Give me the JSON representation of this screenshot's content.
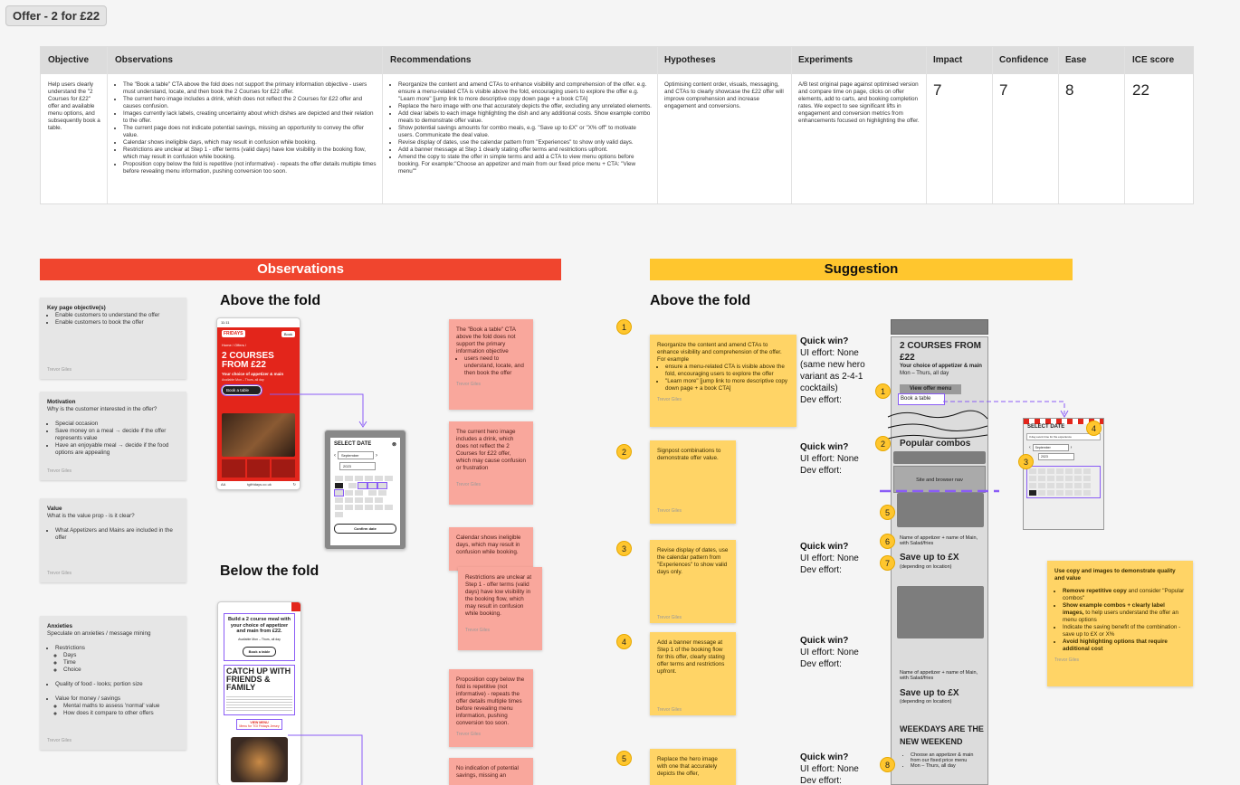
{
  "frame": {
    "title": "Offer - 2 for £22"
  },
  "table": {
    "headers": [
      "Objective",
      "Observations",
      "Recommendations",
      "Hypotheses",
      "Experiments",
      "Impact",
      "Confidence",
      "Ease",
      "ICE score"
    ],
    "objective": "Help users clearly understand the \"2 Courses for £22\" offer and available menu options, and subsequently book a table.",
    "observations": [
      "The \"Book a table\" CTA above the fold does not support the primary information objective - users must understand, locate, and then book the 2 Courses for £22 offer.",
      "The current hero image includes a drink, which does not reflect the 2 Courses for £22 offer and causes confusion.",
      "Images currently lack labels, creating uncertainty about which dishes are depicted and their relation to the offer.",
      "The current page does not indicate potential savings, missing an opportunity to convey the offer value.",
      "Calendar shows ineligible days, which may result in confusion while booking.",
      "Restrictions are unclear at Step 1 - offer terms (valid days) have low visibility in the booking flow, which may result in confusion while booking.",
      "Proposition copy below the fold is repetitive (not informative) - repeats the offer details multiple times before revealing menu information, pushing conversion too soon."
    ],
    "recommendations": [
      "Reorganize the content and amend CTAs to enhance visibility and comprehension of the offer. e.g. ensure a menu-related CTA is visible above the fold, encouraging users to explore the offer e.g. \"Learn more\" [jump link to more descriptive copy down page + a book CTA]",
      "Replace the hero image with one that accurately depicts the offer, excluding any unrelated elements.",
      "Add clear labels to each image highlighting the dish and any additional costs. Show example combo meals to demonstrate offer value.",
      "Show potential savings amounts for combo meals, e.g. \"Save up to £X\" or \"X% off\" to motivate users. Communicate the deal value.",
      "Revise display of dates, use the calendar pattern from \"Experiences\" to show only valid days.",
      "Add a banner message at Step 1 clearly stating offer terms and restrictions upfront.",
      "Amend the copy to state the offer in simple terms and add a CTA to view menu options before booking. For example:\"Choose an appetizer and main from our fixed price menu + CTA: \"View menu\"\""
    ],
    "hypotheses": "Optimising content order, visuals, messaging, and CTAs to clearly showcase the £22 offer will improve comprehension and increase engagement and conversions.",
    "experiments": "A/B test original page against optimised version and compare time on page, clicks on offer elements, add to carts, and booking completion rates. We expect to see significant lifts in engagement and conversion metrics from enhancements focused on highlighting the offer.",
    "impact": "7",
    "confidence": "7",
    "ease": "8",
    "ice": "22"
  },
  "obs_banner": "Observations",
  "sug_banner": "Suggestion",
  "above_fold": "Above the fold",
  "below_fold": "Below the fold",
  "cards": {
    "key": {
      "title": "Key page objective(s)",
      "items": [
        "Enable customers to understand the offer",
        "Enable customers to book the offer"
      ],
      "author": "Trevor Giles"
    },
    "motivation": {
      "title": "Motivation",
      "sub": "Why is the customer interested in the offer?",
      "items": [
        "Special occasion",
        "Save money on a meal → decide if the offer represents value",
        "Have an enjoyable meal → decide if the food options are appealing"
      ],
      "author": "Trevor Giles"
    },
    "value": {
      "title": "Value",
      "sub": "What is the value prop - is it clear?",
      "items": [
        "What Appetizers and Mains are included in the offer"
      ],
      "author": "Trevor Giles"
    },
    "anxieties": {
      "title": "Anxieties",
      "sub": "Speculate on anxieties / message mining",
      "l1": "Restrictions",
      "l1sub": [
        "Days",
        "Time",
        "Choice"
      ],
      "l2": "Quality of food - looks; portion size",
      "l3": "Value for money / savings",
      "l3sub": [
        "Mental maths to assess 'normal' value",
        "How does it compare to other offers"
      ],
      "author": "Trevor Giles"
    }
  },
  "pink": {
    "p1": {
      "text": "The \"Book a table\" CTA above the fold does not support the primary information objective",
      "bullet": "users need to understand, locate, and then book the offer",
      "author": "Trevor Giles"
    },
    "p2": {
      "text": "The current hero image includes a drink, which does not reflect the 2 Courses for £22 offer, which may cause confusion or frustration",
      "author": "Trevor Giles"
    },
    "p3": {
      "text": "Calendar shows ineligible days, which may result in confusion while booking.",
      "author": ""
    },
    "p4": {
      "text": "Restrictions are unclear at Step 1 - offer terms (valid days) have low visibility in the booking flow, which may result in confusion while booking.",
      "author": "Trevor Giles"
    },
    "p5": {
      "text": "Proposition copy below the fold is repetitive (not informative) - repeats the offer details multiple times before revealing menu information, pushing conversion too soon.",
      "author": "Trevor Giles"
    },
    "p6": {
      "text": "No indication of potential savings, missing an"
    }
  },
  "phone": {
    "time": "11:11",
    "brand": "FRIDAYS",
    "book": "Book",
    "crumb": "Home / Offers /",
    "headline": "2 COURSES FROM £22",
    "sub": "Your choice of appetizer & main",
    "avail": "Available Mon – Thurs, all day",
    "cta": "Book a table",
    "url": "tgifridays.co.uk",
    "aa": "AA",
    "select_date": "SELECT DATE",
    "month": "September",
    "year": "2023",
    "confirm": "Confirm date",
    "below_head": "Build a 2 course meal with your choice of appetizer and main from £22.",
    "below_avail": "Available Mon – Thurs, all day",
    "below_cta": "Book a table",
    "catch": "CATCH UP WITH FRIENDS & FAMILY",
    "view_menu": "VIEW MENU",
    "menu_link": "Menu for TGI Fridays Jersey"
  },
  "suggest": {
    "n1": "1",
    "n2": "2",
    "n3": "3",
    "n4": "4",
    "n5": "5",
    "s1": {
      "text": "Reorganize the content and amend CTAs to enhance visibility and comprehension of the offer. For example",
      "b1": "ensure a menu-related CTA is visible above the fold, encouraging users to explore the offer",
      "b2": "\"Learn more\" [jump link to more descriptive copy down page + a book CTA]",
      "author": "Trevor Giles"
    },
    "s2": {
      "text": "Signpost combinations to demonstrate offer value.",
      "author": "Trevor Giles"
    },
    "s3": {
      "text": "Revise display of dates, use the calendar pattern from \"Experiences\" to show valid days only.",
      "author": "Trevor Giles"
    },
    "s4": {
      "text": "Add a banner message at Step 1 of the booking flow for this offer, clearly stating offer terms and restrictions upfront.",
      "author": "Trevor Giles"
    },
    "s5": {
      "text": "Replace the hero image with one that accurately depicts the offer,"
    },
    "qw_title": "Quick win?",
    "qw1_ui": "UI effort: None (same new hero variant as 2-4-1 cocktails)",
    "qw_ui": "UI effort: None",
    "qw_dev": "Dev effort:",
    "big": {
      "title": "Use copy and images to demonstrate quality and value",
      "b1a": "Remove repetitive copy",
      "b1b": " and consider \"Popular combos\"",
      "b2a": "Show example combos + clearly label images,",
      "b2b": " to help users understand the offer an menu options",
      "b3": "Indicate the saving benefit of the combination - save up to £X or X%",
      "b4": "Avoid highlighting options that require additional cost",
      "author": "Trevor Giles"
    }
  },
  "wire": {
    "headline": "2 COURSES FROM £22",
    "sub": "Your choice of appetizer & main",
    "days": "Mon – Thurs, all day",
    "view_menu": "View offer menu",
    "book": "Book a table",
    "popular": "Popular combos",
    "nav": "Site and browser nav",
    "item": "Name of appetizer + name of Main, with Salad/fries",
    "save": "Save up to £X",
    "depending": "(depending on location)",
    "weekdays": "WEEKDAYS ARE THE NEW WEEKEND",
    "b1": "Choose an appetizer & main from our fixed price menu",
    "b2": "Mon – Thurs, all day",
    "n1": "1",
    "n2": "2",
    "n5": "5",
    "n6": "6",
    "n7": "7",
    "n8": "8"
  },
  "cal": {
    "title": "SELECT DATE",
    "banner": "3 day event time for the experience",
    "month": "September",
    "year": "2023",
    "n3": "3",
    "n4": "4"
  },
  "colors": {
    "red": "#f0452e",
    "yellow": "#ffc62e",
    "pink": "#f9a79c",
    "sticky": "#ffd466"
  }
}
